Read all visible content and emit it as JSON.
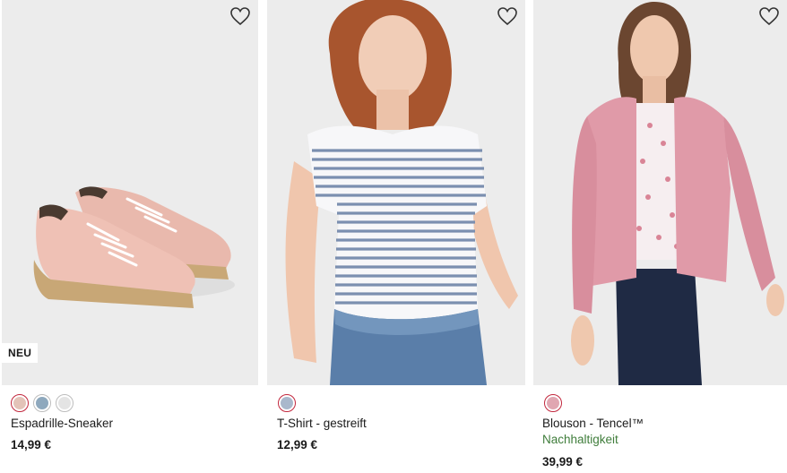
{
  "products": [
    {
      "badge": "NEU",
      "title": "Espadrille-Sneaker",
      "price": "14,99 €",
      "swatch_colors": [
        "#e3c3b8",
        "#8ea8bd",
        "#e4e4e4"
      ],
      "image_icon": "espadrille-sneaker-image"
    },
    {
      "title": "T-Shirt - gestreift",
      "price": "12,99 €",
      "swatch_colors": [
        "#a9b8cc"
      ],
      "image_icon": "striped-tshirt-image"
    },
    {
      "title": "Blouson - Tencel™",
      "subtitle": "Nachhaltigkeit",
      "price": "39,99 €",
      "swatch_colors": [
        "#e0a6b1"
      ],
      "image_icon": "blouson-image"
    }
  ],
  "colors": {
    "image_background": "#ececec",
    "selected_swatch_ring": "#c2273d",
    "sustainability_green": "#3f7d3b"
  }
}
